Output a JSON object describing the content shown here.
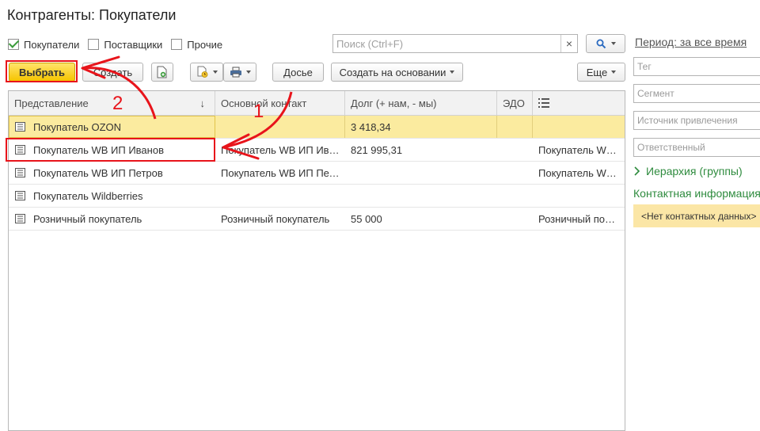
{
  "window": {
    "title": "Контрагенты: Покупатели"
  },
  "filters": [
    {
      "label": "Покупатели",
      "checked": true
    },
    {
      "label": "Поставщики",
      "checked": false
    },
    {
      "label": "Прочие",
      "checked": false
    }
  ],
  "search": {
    "placeholder": "Поиск (Ctrl+F)",
    "value": "",
    "clear_icon": "×"
  },
  "toolbar": {
    "choose_label": "Выбрать",
    "create_label": "Создать",
    "dossier_label": "Досье",
    "create_based_label": "Создать на основании",
    "more_label": "Еще"
  },
  "table": {
    "columns": [
      "Представление",
      "Основной контакт",
      "Долг (+ нам, - мы)",
      "ЭДО",
      ""
    ],
    "sort_indicator": "↓",
    "rows": [
      {
        "name": "Покупатель OZON",
        "contact": "",
        "debt": "3 418,34",
        "edo": "",
        "extra": ""
      },
      {
        "name": "Покупатель WB ИП Иванов",
        "contact": "Покупатель WB ИП Иванов",
        "debt": "821 995,31",
        "edo": "",
        "extra": "Покупатель WB ИП Иванов"
      },
      {
        "name": "Покупатель WB ИП Петров",
        "contact": "Покупатель WB ИП Петров",
        "debt": "",
        "edo": "",
        "extra": "Покупатель WB ИП Петров"
      },
      {
        "name": "Покупатель Wildberries",
        "contact": "",
        "debt": "",
        "edo": "",
        "extra": ""
      },
      {
        "name": "Розничный покупатель",
        "contact": "Розничный покупатель",
        "debt": "55 000",
        "edo": "",
        "extra": "Розничный покупатель"
      }
    ]
  },
  "right_panel": {
    "period_label": "Период: за все время",
    "fields": [
      "Тег",
      "Сегмент",
      "Источник привлечения",
      "Ответственный"
    ],
    "hierarchy_label": "Иерархия (группы)",
    "contact_info_label": "Контактная информация",
    "no_contact_label": "<Нет контактных данных>"
  },
  "annotations": {
    "step1": "1",
    "step2": "2"
  },
  "colors": {
    "accent_yellow": "#f6c400",
    "selected_row": "#fbeb9f",
    "annotation_red": "#e8141b",
    "link_green": "#2e8b3e"
  }
}
